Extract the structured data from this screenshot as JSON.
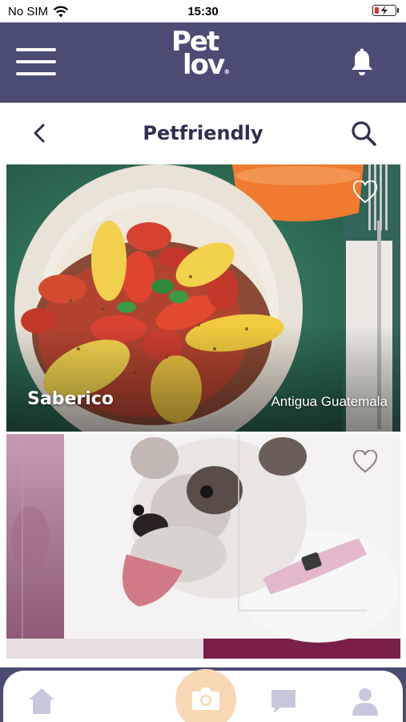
{
  "status_bar": {
    "carrier": "No SIM",
    "time": "15:30",
    "battery_level": 0.2,
    "battery_color": "#e0302d"
  },
  "app_bar": {
    "logo_line1": "Pet",
    "logo_line2": "lov",
    "logo_mark": "®",
    "background": "#4a4c74",
    "menu_icon": "hamburger-icon",
    "bell_icon": "bell-icon"
  },
  "sub_bar": {
    "title": "Petfriendly",
    "back_icon": "chevron-left-icon",
    "search_icon": "search-icon"
  },
  "cards": [
    {
      "title": "Saberico",
      "location": "Antigua Guatemala",
      "favorite_icon": "heart-outline-icon",
      "image": "fruit salad bowl"
    },
    {
      "title": "",
      "location": "",
      "favorite_icon": "heart-outline-icon",
      "image": "bulldog"
    }
  ],
  "bottom_nav": {
    "items": [
      {
        "name": "home",
        "icon": "home-icon"
      },
      {
        "name": "camera",
        "icon": "camera-icon"
      },
      {
        "name": "messages",
        "icon": "chat-icon"
      },
      {
        "name": "profile",
        "icon": "user-icon"
      }
    ],
    "accent": "#f8d7b4",
    "inactive_icon_color": "#c6c9dd"
  }
}
